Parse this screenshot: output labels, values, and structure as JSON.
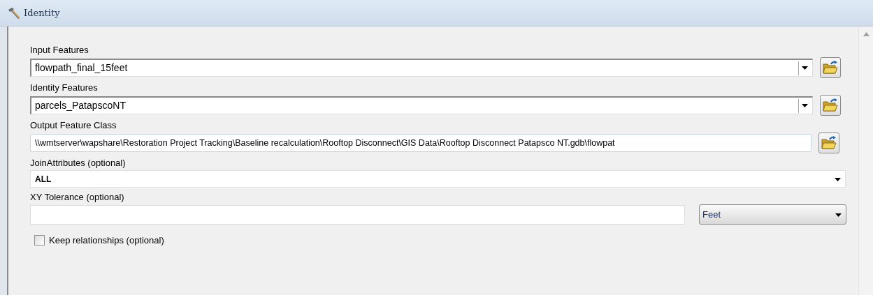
{
  "window": {
    "title": "Identity"
  },
  "parameters": [
    {
      "kind": "combo-browse",
      "label": "Input Features",
      "value": "flowpath_final_15feet"
    },
    {
      "kind": "combo-browse",
      "label": "Identity Features",
      "value": "parcels_PatapscoNT"
    },
    {
      "kind": "text-browse",
      "label": "Output Feature Class",
      "value": "\\\\wmtserver\\wapshare\\Restoration Project Tracking\\Baseline recalculation\\Rooftop Disconnect\\GIS Data\\Rooftop Disconnect Patapsco NT.gdb\\flowpat"
    },
    {
      "kind": "select",
      "label": "JoinAttributes (optional)",
      "value": "ALL"
    },
    {
      "kind": "number-unit",
      "label": "XY Tolerance (optional)",
      "unit": "Feet"
    },
    {
      "kind": "checkbox",
      "label": "Keep relationships (optional)",
      "checked": false
    }
  ]
}
